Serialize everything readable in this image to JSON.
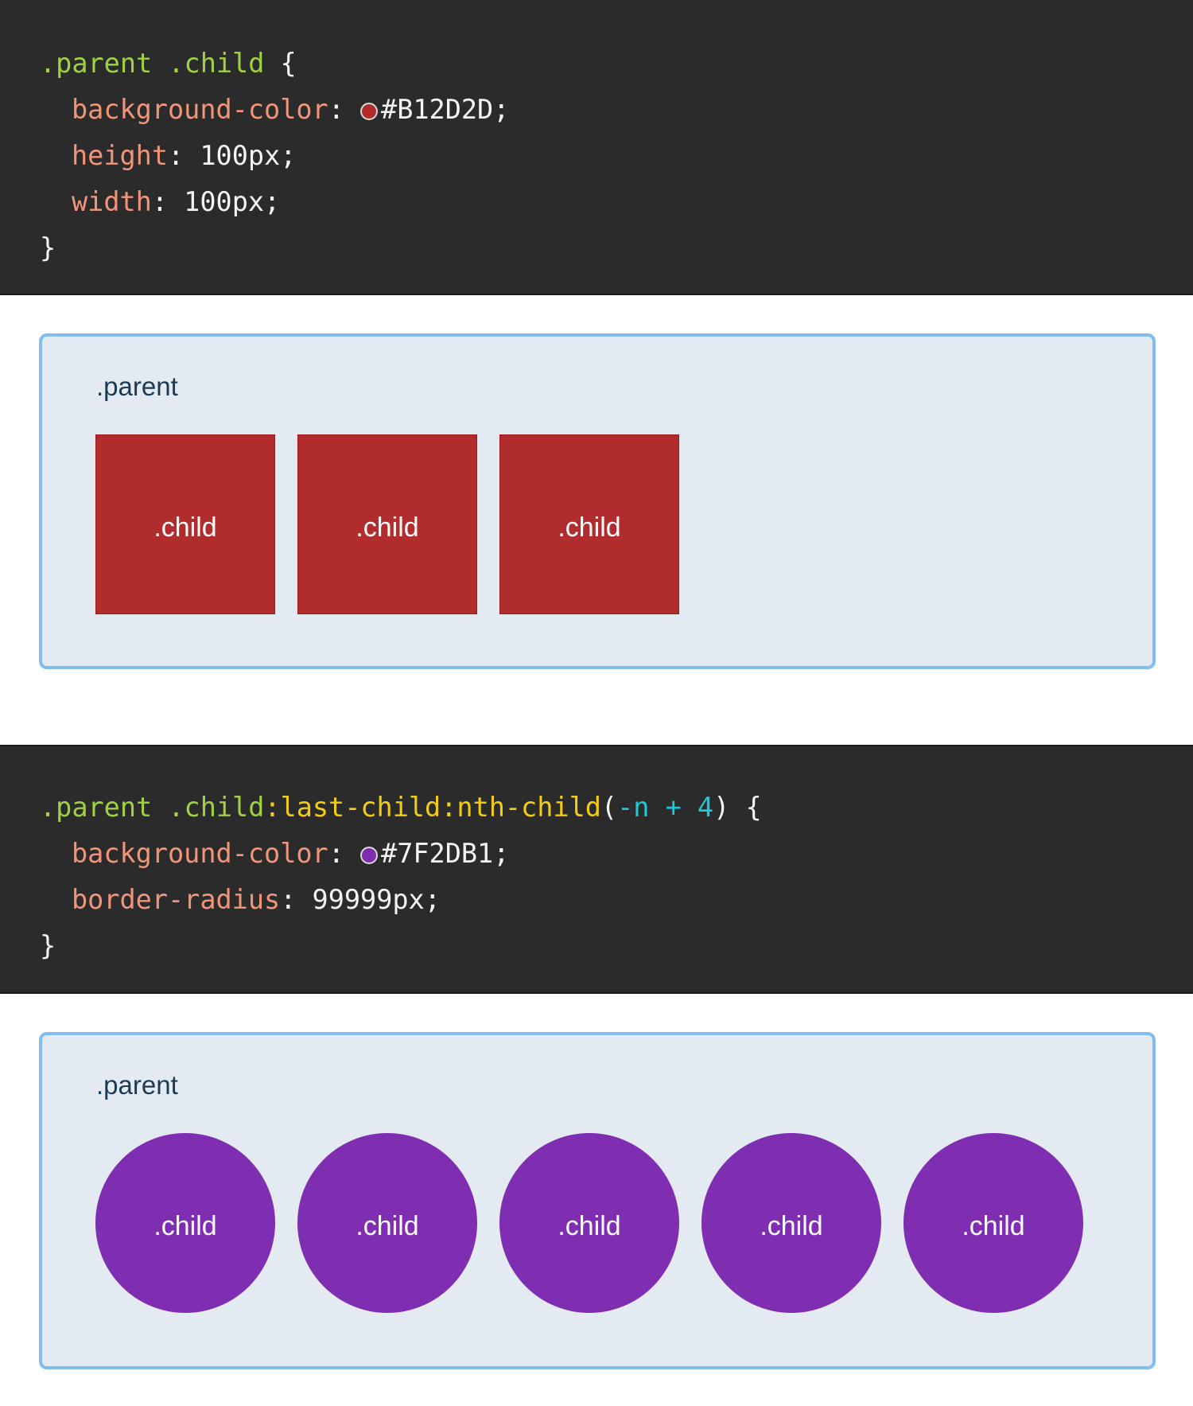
{
  "code_block_1": {
    "line1": {
      "selector_parent": ".parent",
      "selector_child": ".child",
      "open_brace": "{"
    },
    "line2": {
      "property": "background-color",
      "colon": ":",
      "swatch_color": "#B12D2D",
      "value": "#B12D2D;"
    },
    "line3": {
      "property": "height",
      "colon": ":",
      "value": " 100px;"
    },
    "line4": {
      "property": "width",
      "colon": ":",
      "value": " 100px;"
    },
    "close_brace": "}"
  },
  "demo_1": {
    "parent_label": ".parent",
    "child_color": "#B12D2D",
    "children": [
      ".child",
      ".child",
      ".child"
    ]
  },
  "code_block_2": {
    "line1": {
      "selector_parent": ".parent",
      "selector_child": ".child",
      "pseudo": ":last-child:nth-child",
      "open_paren": "(",
      "arg": "-n + 4",
      "close_paren": ")",
      "open_brace": "{"
    },
    "line2": {
      "property": "background-color",
      "colon": ":",
      "swatch_color": "#7F2DB1",
      "value": "#7F2DB1;"
    },
    "line3": {
      "property": "border-radius",
      "colon": ":",
      "value": " 99999px;"
    },
    "close_brace": "}"
  },
  "demo_2": {
    "parent_label": ".parent",
    "child_color": "#7F2DB1",
    "children": [
      ".child",
      ".child",
      ".child",
      ".child",
      ".child"
    ]
  }
}
